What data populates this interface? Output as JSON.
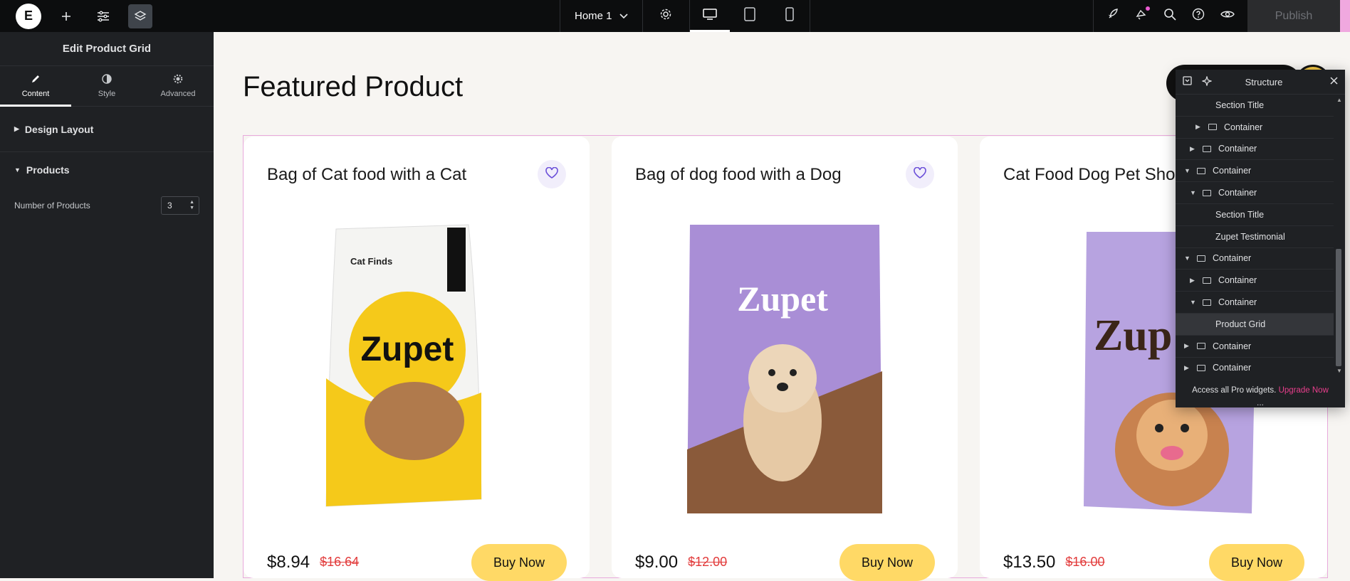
{
  "topbar": {
    "page_name": "Home 1",
    "publish_label": "Publish"
  },
  "panel": {
    "title": "Edit Product Grid",
    "tabs": [
      {
        "label": "Content"
      },
      {
        "label": "Style"
      },
      {
        "label": "Advanced"
      }
    ],
    "sections": {
      "design_layout": "Design Layout",
      "products": "Products"
    },
    "num_products_label": "Number of Products",
    "num_products_value": "3"
  },
  "canvas": {
    "title": "Featured Product",
    "products": [
      {
        "name": "Bag of Cat food with a Cat",
        "price": "$8.94",
        "old_price": "$16.64",
        "button": "Buy Now",
        "brand": "Zupet"
      },
      {
        "name": "Bag of dog food with a Dog",
        "price": "$9.00",
        "old_price": "$12.00",
        "button": "Buy Now",
        "brand": "Zupet"
      },
      {
        "name": "Cat Food Dog Pet Shop",
        "price": "$13.50",
        "old_price": "$16.00",
        "button": "Buy Now",
        "brand": "Zup"
      }
    ]
  },
  "structure": {
    "title": "Structure",
    "rows": [
      {
        "label": "Section Title",
        "indent": 2,
        "arrow": "",
        "box": false
      },
      {
        "label": "Container",
        "indent": 2,
        "arrow": "right",
        "box": true
      },
      {
        "label": "Container",
        "indent": 1,
        "arrow": "right",
        "box": true
      },
      {
        "label": "Container",
        "indent": 0,
        "arrow": "down",
        "box": true
      },
      {
        "label": "Container",
        "indent": 1,
        "arrow": "down",
        "box": true
      },
      {
        "label": "Section Title",
        "indent": 2,
        "arrow": "",
        "box": false
      },
      {
        "label": "Zupet Testimonial",
        "indent": 2,
        "arrow": "",
        "box": false
      },
      {
        "label": "Container",
        "indent": 0,
        "arrow": "down",
        "box": true
      },
      {
        "label": "Container",
        "indent": 1,
        "arrow": "right",
        "box": true
      },
      {
        "label": "Container",
        "indent": 1,
        "arrow": "down",
        "box": true
      },
      {
        "label": "Product Grid",
        "indent": 2,
        "arrow": "",
        "box": false,
        "selected": true
      },
      {
        "label": "Container",
        "indent": 0,
        "arrow": "right",
        "box": true
      },
      {
        "label": "Container",
        "indent": 0,
        "arrow": "right",
        "box": true
      }
    ],
    "footer_text": "Access all Pro widgets.",
    "footer_link": "Upgrade Now",
    "more": "..."
  }
}
